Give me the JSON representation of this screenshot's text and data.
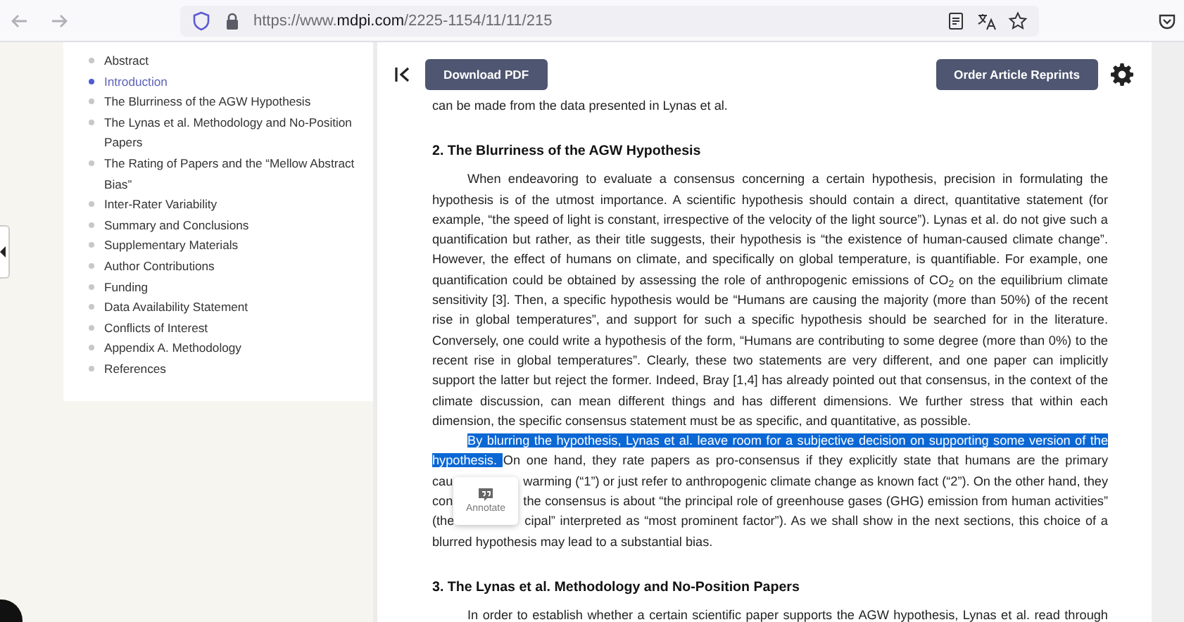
{
  "browser": {
    "url_prefix": "https://www.",
    "url_domain": "mdpi.com",
    "url_path": "/2225-1154/11/11/215"
  },
  "sidebar": {
    "items": [
      {
        "label": "Abstract",
        "selected": false
      },
      {
        "label": "Introduction",
        "selected": true
      },
      {
        "label": "The Blurriness of the AGW Hypothesis",
        "selected": false
      },
      {
        "label": "The Lynas et al. Methodology and No-Position Papers",
        "selected": false
      },
      {
        "label": "The Rating of Papers and the “Mellow Abstract Bias”",
        "selected": false
      },
      {
        "label": "Inter-Rater Variability",
        "selected": false
      },
      {
        "label": "Summary and Conclusions",
        "selected": false
      },
      {
        "label": "Supplementary Materials",
        "selected": false
      },
      {
        "label": "Author Contributions",
        "selected": false
      },
      {
        "label": "Funding",
        "selected": false
      },
      {
        "label": "Data Availability Statement",
        "selected": false
      },
      {
        "label": "Conflicts of Interest",
        "selected": false
      },
      {
        "label": "Appendix A. Methodology",
        "selected": false
      },
      {
        "label": "References",
        "selected": false
      }
    ]
  },
  "toolbar": {
    "download_button": "Download PDF",
    "reprints_button": "Order Article Reprints"
  },
  "article": {
    "blocks": [
      {
        "kind": "paragraph",
        "indent": false,
        "complete": true,
        "lines": [
          "can be made from the data presented in Lynas et al."
        ]
      },
      {
        "kind": "heading",
        "text": "2. The Blurriness of the AGW Hypothesis"
      },
      {
        "kind": "paragraph",
        "indent": true,
        "complete": true,
        "lines": [
          "When endeavoring to evaluate a consensus concerning a certain hypothesis, precision in formulating the",
          "hypothesis is of the utmost importance. A scientific hypothesis should contain a direct, quantitative statement (for",
          "example, “the speed of light is constant, irrespective of the velocity of the light source”). Lynas et al. do not give such a",
          "quantification but rather, as their title suggests, their hypothesis is “the existence of human-caused climate change”.",
          "However, the effect of humans on climate, and specifically on global temperature, is quantifiable. For example, one",
          "quantification could be obtained by assessing the role of anthropogenic emissions of CO$_{2}$ on the equilibrium climate",
          "sensitivity [3]. Then, a specific hypothesis would be “Humans are causing the majority (more than 50%) of the recent",
          "rise in global temperatures”, and support for such a specific hypothesis should be searched for in the literature.",
          "Conversely, one could write a hypothesis of the form, “Humans are contributing to some degree (more than 0%) to the",
          "recent rise in global temperatures”. Clearly, these two statements are very different, and one paper can implicitly",
          "support the latter but reject the former. Indeed, Bray [1,4] has already pointed out that consensus, in the context of the",
          "climate discussion, can mean different things and has different dimensions. We further stress that within each",
          "dimension, the specific consensus statement must be as specific, and quantitative, as possible."
        ]
      },
      {
        "kind": "segmented_paragraph",
        "indent": true,
        "complete": true,
        "lines": [
          {
            "segments": [
              {
                "kind": "text",
                "text": "By blurring the hypothesis, Lynas et al. leave room for a subjective decision on supporting some version of the",
                "selected": true
              }
            ]
          },
          {
            "segments": [
              {
                "kind": "text",
                "text": "hypothesis. ",
                "selected": true
              },
              {
                "kind": "text",
                "text": "On one hand, they rate papers as pro-consensus if they explicitly state that humans are the primary",
                "selected": false
              }
            ]
          },
          {
            "segments": [
              {
                "kind": "text",
                "text": "cau",
                "selected": false
              },
              {
                "kind": "gap"
              },
              {
                "kind": "text",
                "text": "warming (“1”) or just refer to anthropogenic climate change as known fact (“2”). On the other hand, they",
                "selected": false
              }
            ]
          },
          {
            "segments": [
              {
                "kind": "text",
                "text": "con",
                "selected": false
              },
              {
                "kind": "gap"
              },
              {
                "kind": "text",
                "text": "the consensus is about “the principal role of greenhouse gases (GHG) emission from human activities”",
                "selected": false
              }
            ]
          },
          {
            "segments": [
              {
                "kind": "text",
                "text": "(the",
                "selected": false
              },
              {
                "kind": "gap"
              },
              {
                "kind": "text",
                "text": "cipal” interpreted as “most prominent factor”). As we shall show in the next sections, this choice of a",
                "selected": false
              }
            ]
          },
          {
            "segments": [
              {
                "kind": "text",
                "text": "blurred hypothesis may lead to a substantial bias.",
                "selected": false
              }
            ]
          }
        ]
      },
      {
        "kind": "heading",
        "text": "3. The Lynas et al. Methodology and No-Position Papers"
      },
      {
        "kind": "paragraph",
        "indent": true,
        "complete": false,
        "lines": [
          "In order to establish whether a certain scientific paper supports the AGW hypothesis, Lynas et al. read through"
        ]
      }
    ]
  },
  "annotate_popup": {
    "label": "Annotate"
  }
}
